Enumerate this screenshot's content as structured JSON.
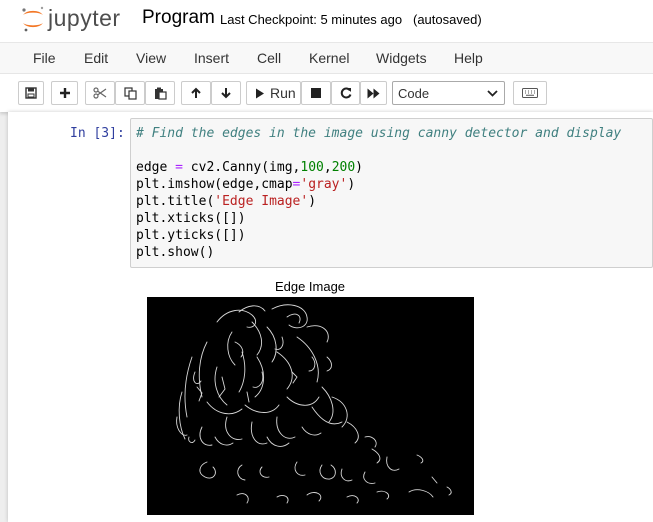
{
  "header": {
    "logo_text": "jupyter",
    "notebook_name": "Program",
    "checkpoint": "Last Checkpoint: 5 minutes ago",
    "autosave": "(autosaved)"
  },
  "menu": [
    "File",
    "Edit",
    "View",
    "Insert",
    "Cell",
    "Kernel",
    "Widgets",
    "Help"
  ],
  "toolbar": {
    "run_label": "Run",
    "cell_type": "Code"
  },
  "cell": {
    "prompt": "In [3]:",
    "comment": "# Find the edges in the image using canny detector and display",
    "line1_a": "edge ",
    "line1_op": "=",
    "line1_b": " cv2.Canny(img,",
    "line1_n1": "100",
    "line1_c": ",",
    "line1_n2": "200",
    "line1_d": ")",
    "line2_a": "plt.imshow(edge,cmap",
    "line2_op": "=",
    "line2_str": "'gray'",
    "line2_b": ")",
    "line3_a": "plt.title(",
    "line3_str": "'Edge Image'",
    "line3_b": ")",
    "line4": "plt.xticks([])",
    "line5": "plt.yticks([])",
    "line6": "plt.show()"
  },
  "output": {
    "title": "Edge Image"
  },
  "colors": {
    "prompt": "#303f9f",
    "comment": "#408080",
    "number": "#008000",
    "string": "#ba2121",
    "logo_orange": "#f37726"
  },
  "icons": [
    "save-icon",
    "plus-icon",
    "scissors-icon",
    "copy-icon",
    "paste-icon",
    "arrow-up-icon",
    "arrow-down-icon",
    "play-icon",
    "stop-icon",
    "restart-icon",
    "fast-forward-icon",
    "chevron-down-icon",
    "keyboard-icon"
  ]
}
